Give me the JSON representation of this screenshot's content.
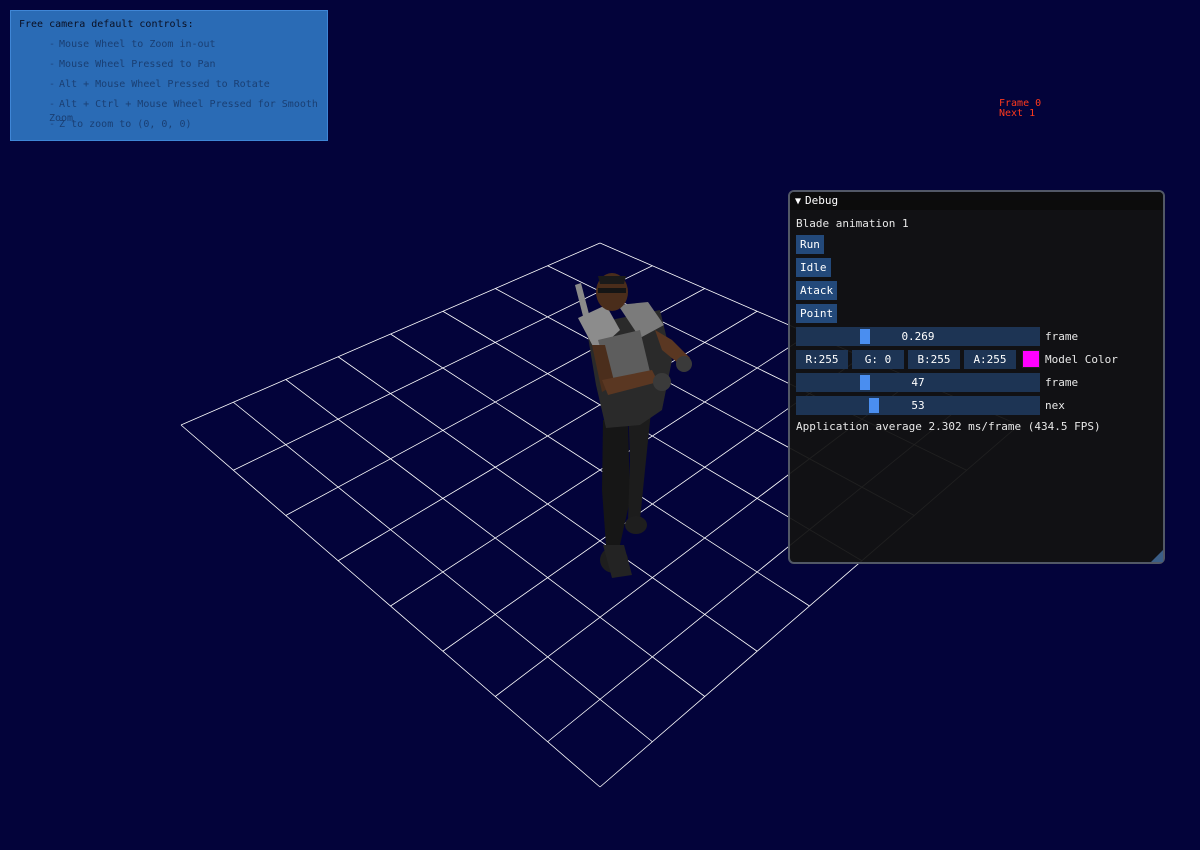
{
  "help": {
    "title": "Free camera default controls:",
    "lines": [
      "Mouse Wheel to Zoom in-out",
      "Mouse Wheel Pressed to Pan",
      "Alt + Mouse Wheel Pressed to Rotate",
      "Alt + Ctrl + Mouse Wheel Pressed for Smooth Zoom",
      "Z to zoom to (0, 0, 0)"
    ],
    "bullet": "-"
  },
  "frame_info": {
    "frame": "Frame 0",
    "next": "Next 1"
  },
  "debug": {
    "title": "Debug",
    "collapse_icon": "triangle-down-icon",
    "model_label": "Blade animation 1",
    "buttons": {
      "run": "Run",
      "idle": "Idle",
      "atack": "Atack",
      "point": "Point"
    },
    "frame_slider": {
      "value": "0.269",
      "fraction": 0.269,
      "label": "frame"
    },
    "model_color": {
      "r": "R:255",
      "g": "G:  0",
      "b": "B:255",
      "a": "A:255",
      "label": "Model Color",
      "swatch": "#ff00ff"
    },
    "frame_int_slider": {
      "value": "47",
      "fraction": 0.27,
      "label": "frame"
    },
    "next_slider": {
      "value": "53",
      "fraction": 0.31,
      "label": "nex"
    },
    "fps_text": "Application average 2.302 ms/frame (434.5 FPS)"
  },
  "colors": {
    "background": "#03033a",
    "grid": "#ffffff",
    "help_bg": "#2a6bb5",
    "frame_text": "#ff3a1c",
    "button_bg": "#23497a",
    "slider_grab": "#4a8ef0"
  }
}
